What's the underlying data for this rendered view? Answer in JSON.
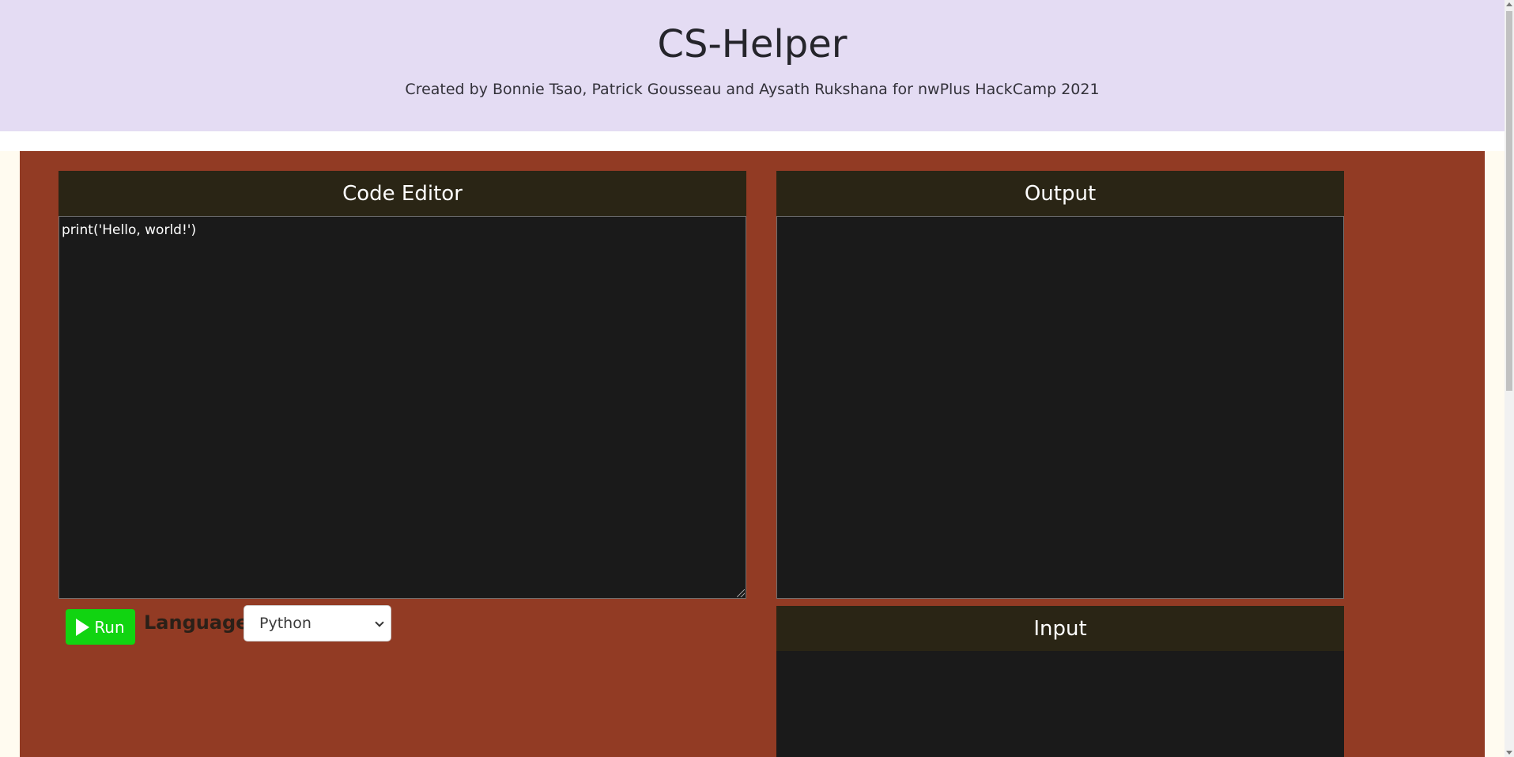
{
  "header": {
    "title": "CS-Helper",
    "subtitle": "Created by Bonnie Tsao, Patrick Gousseau and Aysath Rukshana for nwPlus HackCamp 2021"
  },
  "editor": {
    "title": "Code Editor",
    "code": "print('Hello, world!')"
  },
  "output": {
    "title": "Output",
    "content": ""
  },
  "input": {
    "title": "Input",
    "content": ""
  },
  "controls": {
    "run_label": "Run",
    "run_icon": "play-icon",
    "language_label": "Language:",
    "language_selected": "Python"
  },
  "colors": {
    "header_bg": "#e4dcf3",
    "main_bg": "#923b24",
    "panel_head_bg": "#2a2515",
    "panel_body_bg": "#1a1a1a",
    "run_button_bg": "#11d411"
  }
}
